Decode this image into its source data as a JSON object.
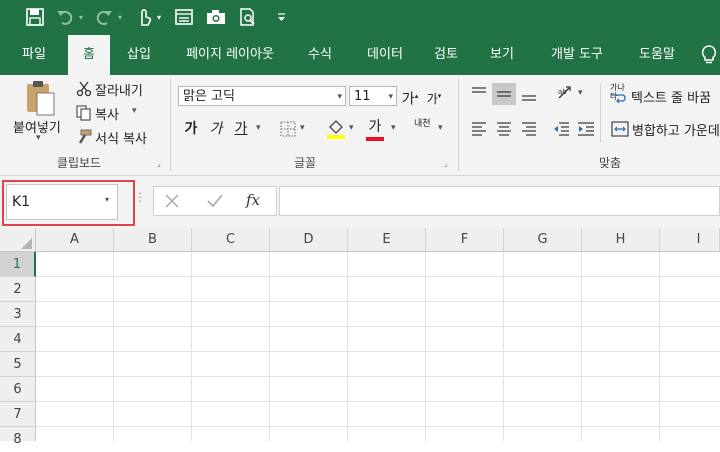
{
  "colors": {
    "excel_green": "#217346",
    "ribbon_bg": "#f3f3f3",
    "highlight_red": "#e0434b",
    "font_red": "#e81123",
    "highlight_yellow": "#ffff00"
  },
  "tabs": [
    "파일",
    "홈",
    "삽입",
    "페이지 레이아웃",
    "수식",
    "데이터",
    "검토",
    "보기",
    "개발 도구",
    "도움말"
  ],
  "clipboard": {
    "paste": "붙여넣기",
    "cut": "잘라내기",
    "copy": "복사",
    "format_painter": "서식 복사",
    "group": "클립보드"
  },
  "font": {
    "name": "맑은 고딕",
    "size": "11",
    "grow": "가",
    "shrink": "가",
    "bold": "가",
    "italic": "가",
    "underline": "가",
    "color_glyph": "가",
    "phonetic": "내천",
    "group": "글꼴"
  },
  "alignment": {
    "wrap_text": "텍스트 줄 바꿈",
    "merge": "병합하고 가운데",
    "group": "맞춤",
    "wrap_badge": "가나다"
  },
  "formula_bar": {
    "name_box": "K1",
    "fx": "fx",
    "formula": ""
  },
  "columns": [
    "A",
    "B",
    "C",
    "D",
    "E",
    "F",
    "G",
    "H",
    "I"
  ],
  "rows": [
    "1",
    "2",
    "3",
    "4",
    "5",
    "6",
    "7",
    "8"
  ],
  "icons": [
    "save-icon",
    "undo-icon",
    "redo-icon",
    "touch-mode-icon",
    "form-icon",
    "camera-icon",
    "print-preview-icon",
    "customize-qat-icon",
    "lightbulb-icon"
  ]
}
